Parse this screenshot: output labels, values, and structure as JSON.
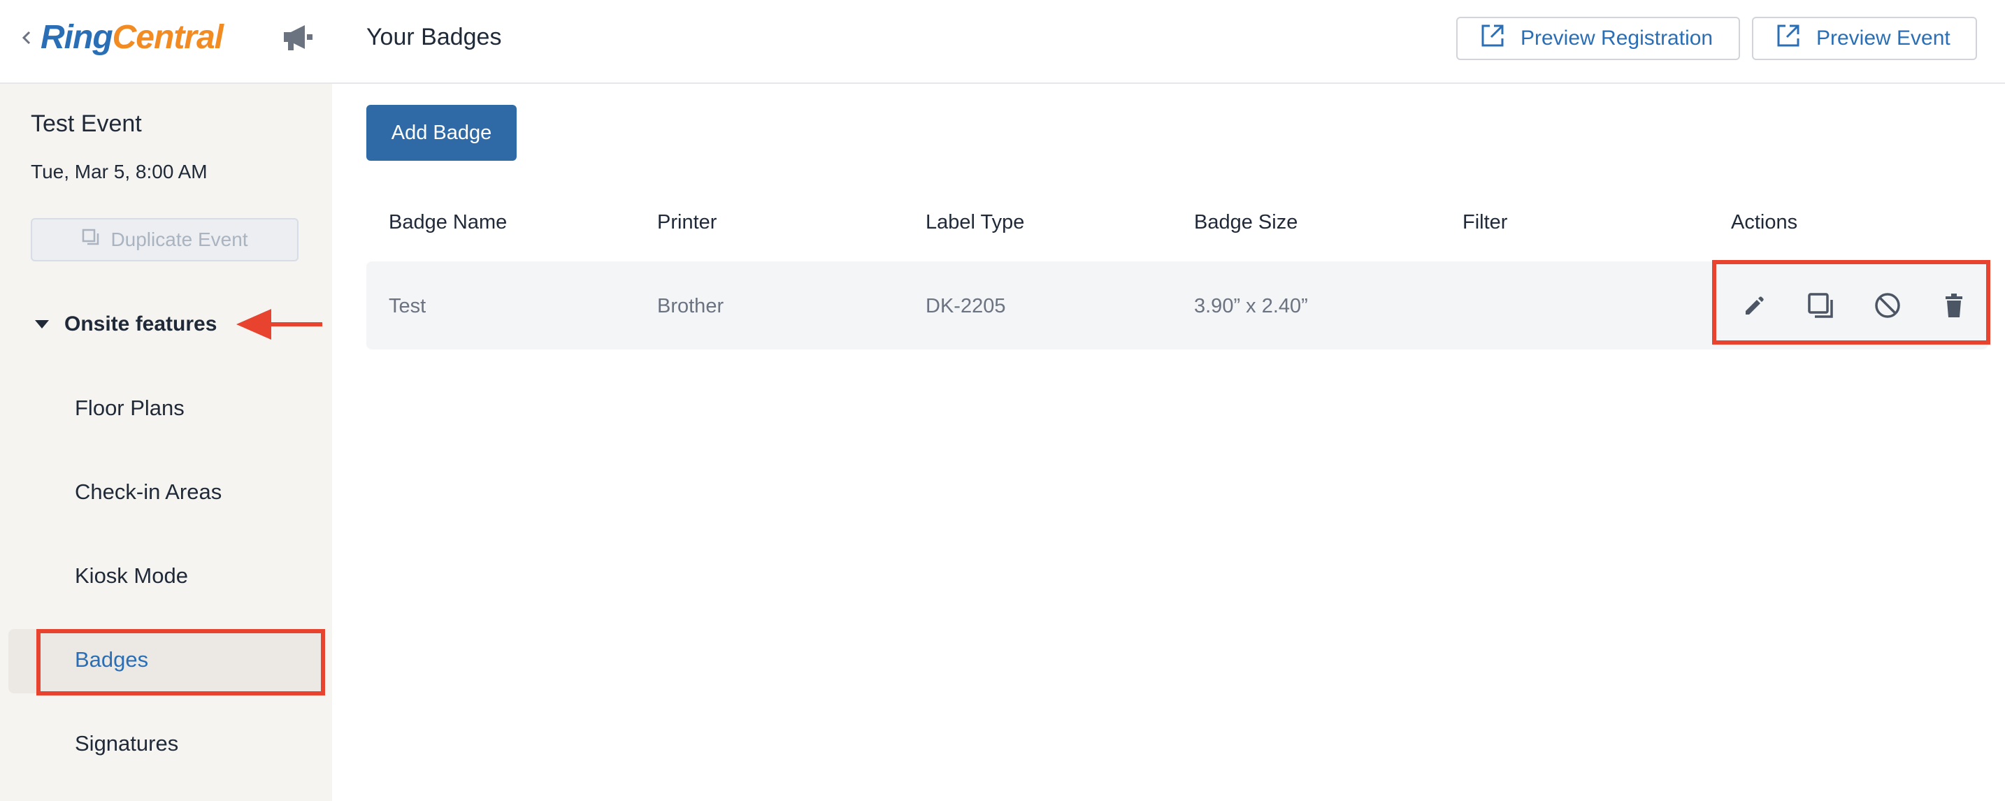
{
  "brand": {
    "ring": "Ring",
    "central": "Central"
  },
  "header": {
    "title": "Your Badges",
    "preview_registration": "Preview Registration",
    "preview_event": "Preview Event"
  },
  "sidebar": {
    "event_title": "Test Event",
    "event_date": "Tue, Mar 5, 8:00 AM",
    "duplicate_label": "Duplicate Event",
    "section_label": "Onsite features",
    "items": [
      {
        "label": "Floor Plans"
      },
      {
        "label": "Check-in Areas"
      },
      {
        "label": "Kiosk Mode"
      },
      {
        "label": "Badges",
        "active": true
      },
      {
        "label": "Signatures"
      }
    ]
  },
  "main": {
    "add_badge_label": "Add Badge",
    "columns": [
      "Badge Name",
      "Printer",
      "Label Type",
      "Badge Size",
      "Filter",
      "Actions"
    ],
    "rows": [
      {
        "badge_name": "Test",
        "printer": "Brother",
        "label_type": "DK-2205",
        "badge_size": "3.90” x 2.40”",
        "filter": ""
      }
    ],
    "actions": [
      "edit-icon",
      "duplicate-icon",
      "disable-icon",
      "delete-icon"
    ]
  },
  "colors": {
    "accent": "#2a6fb6",
    "primary_button": "#2f6aa7",
    "annotation": "#e8432e",
    "logo_orange": "#f28b22"
  }
}
